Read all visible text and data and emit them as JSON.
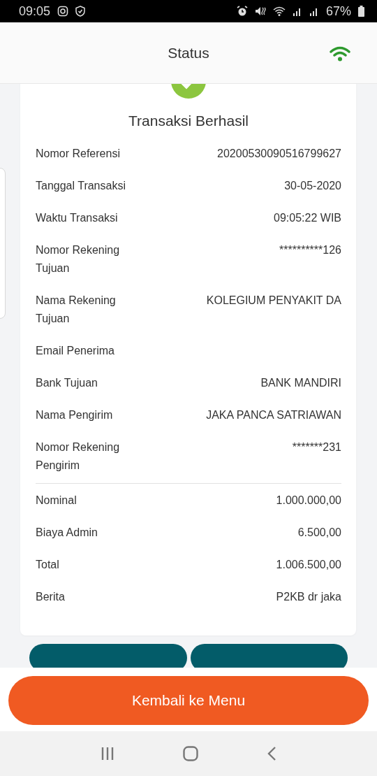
{
  "status_bar": {
    "time": "09:05",
    "battery": "67%"
  },
  "header": {
    "title": "Status"
  },
  "receipt": {
    "title": "Transaksi Berhasil",
    "details": [
      {
        "label": "Nomor Referensi",
        "value": "20200530090516799627"
      },
      {
        "label": "Tanggal Transaksi",
        "value": "30-05-2020"
      },
      {
        "label": "Waktu Transaksi",
        "value": "09:05:22 WIB"
      },
      {
        "label": "Nomor Rekening Tujuan",
        "value": "**********126"
      },
      {
        "label": "Nama Rekening Tujuan",
        "value": "KOLEGIUM PENYAKIT DA"
      },
      {
        "label": "Email Penerima"
      },
      {
        "label": "Bank Tujuan",
        "value": "BANK MANDIRI"
      },
      {
        "label": "Nama Pengirim",
        "value": "JAKA PANCA SATRIAWAN"
      },
      {
        "label": "Nomor Rekening Pengirim",
        "value": "*******231"
      }
    ],
    "amounts": [
      {
        "label": "Nominal",
        "value": "1.000.000,00"
      },
      {
        "label": "Biaya Admin",
        "value": "6.500,00"
      },
      {
        "label": "Total",
        "value": "1.006.500,00"
      },
      {
        "label": "Berita",
        "value": "P2KB dr jaka"
      }
    ]
  },
  "primary_button": {
    "label": "Kembali ke Menu"
  }
}
